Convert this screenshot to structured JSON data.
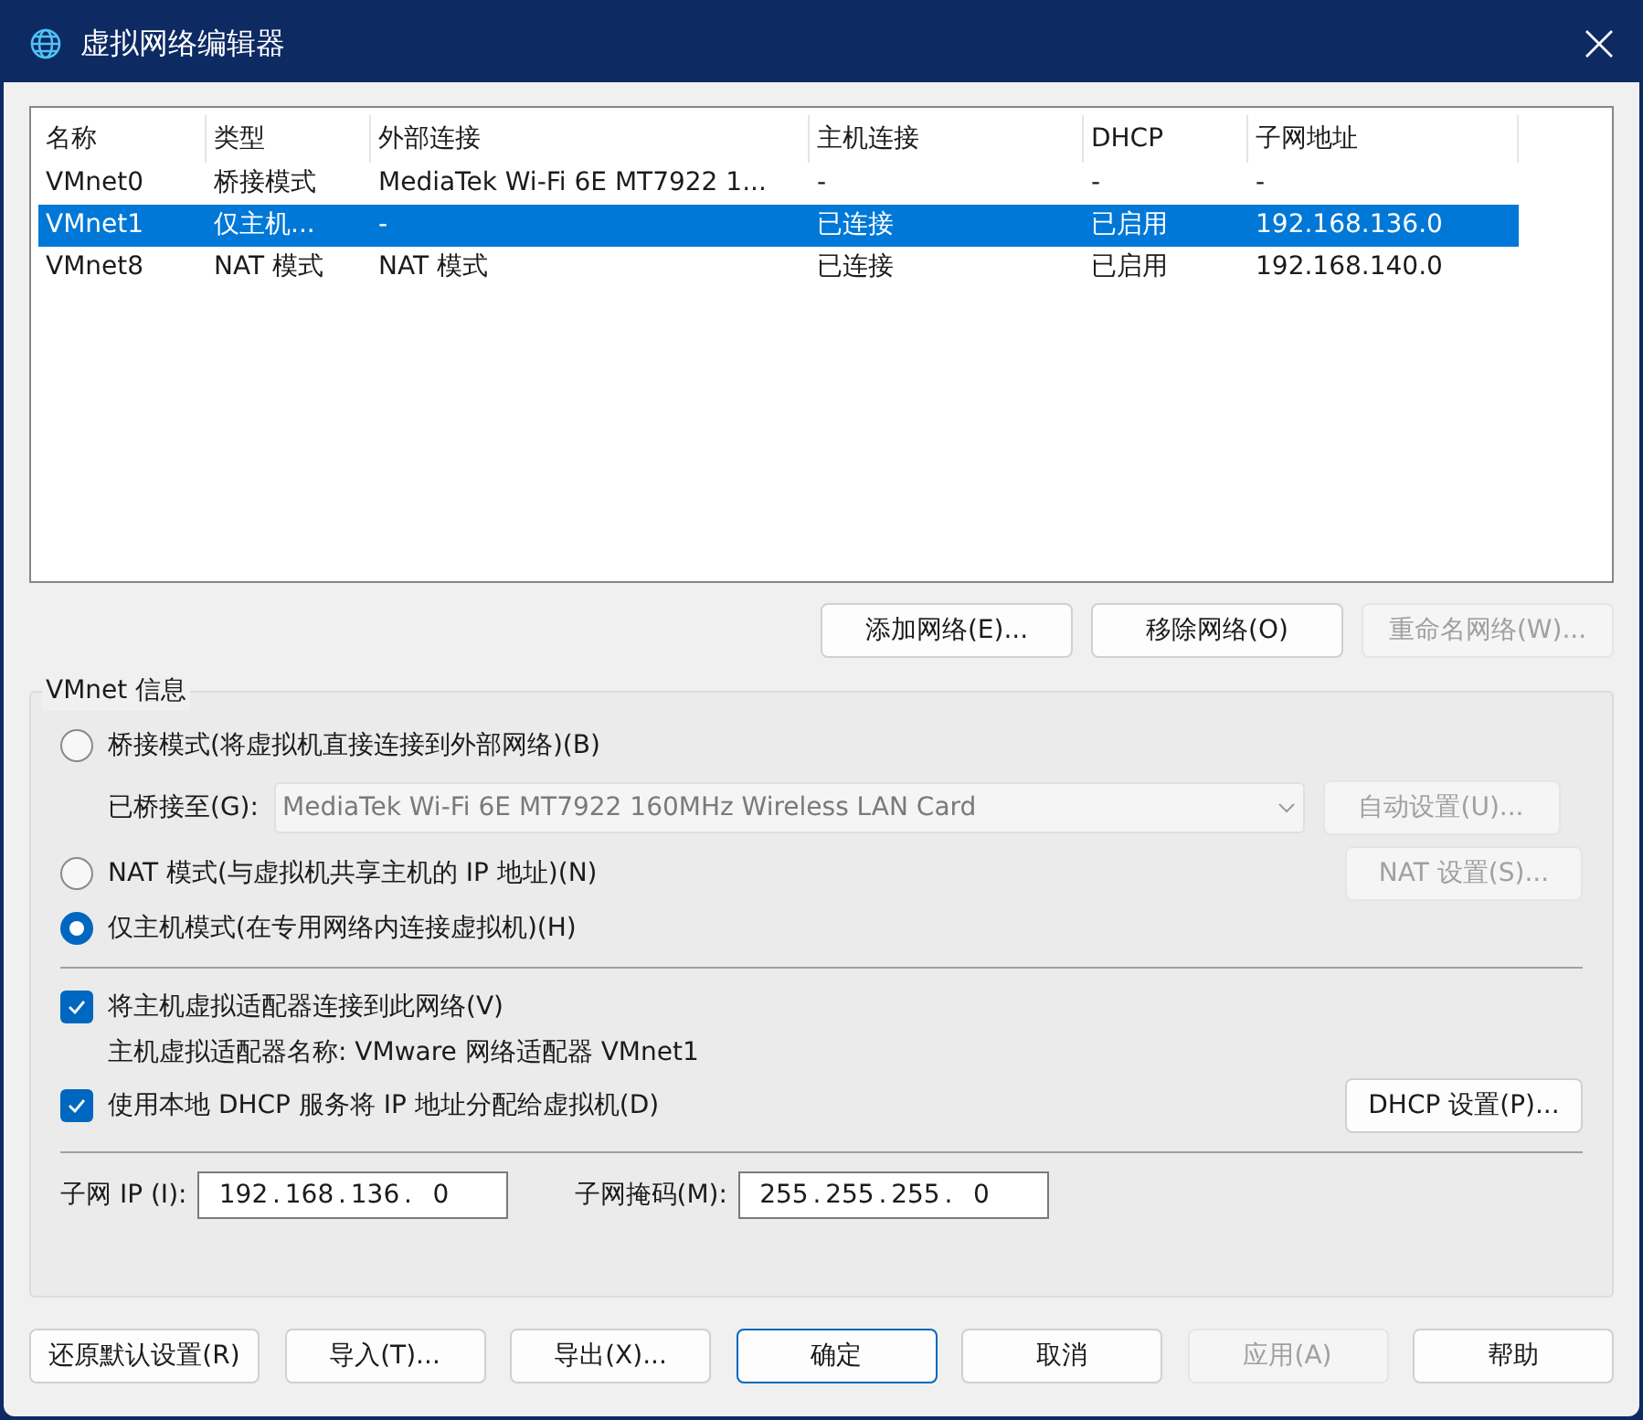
{
  "window": {
    "title": "虚拟网络编辑器"
  },
  "table": {
    "columns": [
      "名称",
      "类型",
      "外部连接",
      "主机连接",
      "DHCP",
      "子网地址"
    ],
    "rows": [
      {
        "cells": [
          "VMnet0",
          "桥接模式",
          "MediaTek Wi-Fi 6E MT7922 1...",
          "-",
          "-",
          "-"
        ],
        "selected": false
      },
      {
        "cells": [
          "VMnet1",
          "仅主机...",
          "-",
          "已连接",
          "已启用",
          "192.168.136.0"
        ],
        "selected": true
      },
      {
        "cells": [
          "VMnet8",
          "NAT 模式",
          "NAT 模式",
          "已连接",
          "已启用",
          "192.168.140.0"
        ],
        "selected": false
      }
    ]
  },
  "table_buttons": [
    {
      "label": "添加网络(E)...",
      "disabled": false
    },
    {
      "label": "移除网络(O)",
      "disabled": false
    },
    {
      "label": "重命名网络(W)...",
      "disabled": true
    }
  ],
  "info": {
    "title": "VMnet 信息",
    "modes": [
      {
        "label": "桥接模式(将虚拟机直接连接到外部网络)(B)",
        "selected": false
      },
      {
        "label": "NAT 模式(与虚拟机共享主机的 IP 地址)(N)",
        "selected": false
      },
      {
        "label": "仅主机模式(在专用网络内连接虚拟机)(H)",
        "selected": true
      }
    ],
    "bridged_to": {
      "label": "已桥接至(G):",
      "value": "MediaTek Wi-Fi 6E MT7922 160MHz Wireless LAN Card",
      "disabled": true
    },
    "auto_button": {
      "label": "自动设置(U)...",
      "disabled": true
    },
    "nat_button": {
      "label": "NAT 设置(S)...",
      "disabled": true
    },
    "connect_adapter": {
      "label": "将主机虚拟适配器连接到此网络(V)",
      "checked": true
    },
    "adapter_name": "主机虚拟适配器名称: VMware 网络适配器 VMnet1",
    "use_dhcp": {
      "label": "使用本地 DHCP 服务将 IP 地址分配给虚拟机(D)",
      "checked": true
    },
    "dhcp_button": {
      "label": "DHCP 设置(P)...",
      "disabled": false
    },
    "subnet_ip": {
      "label": "子网 IP (I):",
      "octets": [
        "192",
        "168",
        "136",
        "0"
      ],
      "separator": "."
    },
    "subnet_mask": {
      "label": "子网掩码(M):",
      "octets": [
        "255",
        "255",
        "255",
        "0"
      ],
      "separator": "."
    }
  },
  "footer_buttons": [
    {
      "label": "还原默认设置(R)",
      "disabled": false,
      "default": false
    },
    {
      "label": "导入(T)...",
      "disabled": false,
      "default": false
    },
    {
      "label": "导出(X)...",
      "disabled": false,
      "default": false
    },
    {
      "label": "确定",
      "disabled": false,
      "default": true
    },
    {
      "label": "取消",
      "disabled": false,
      "default": false
    },
    {
      "label": "应用(A)",
      "disabled": true,
      "default": false
    },
    {
      "label": "帮助",
      "disabled": false,
      "default": false
    }
  ]
}
